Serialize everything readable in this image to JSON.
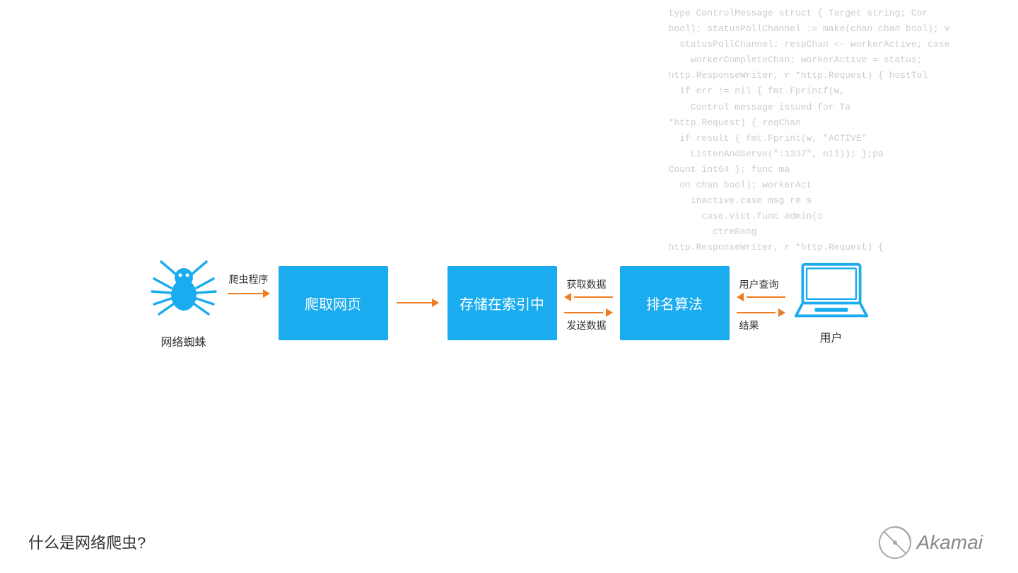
{
  "code": {
    "lines": [
      "  type ControlMessage struct { Target string; Cor",
      "  bool); statusPollChannel := make(chan chan bool); v",
      "    statusPollChannel: respChan <- workerActive; case",
      "      workerCompleteChan: workerActive = status;",
      "  http.ResponseWriter, r *http.Request) { hostTol",
      "    if err != nil { fmt.Fprintf(w,",
      "      Control message issued for Ta",
      "  *http.Request) { reqChan",
      "    if result { fmt.Fprint(w, \"ACTIVE\"",
      "      ListenAndServe(\":1337\", nil)); };pa",
      "  Count int64 }; func ma",
      "    on chan bool); workerAct",
      "      inactive.case msg re s",
      "        case.vict.func admin(c",
      "          ctreRang",
      "  http.ResponseWriter, r *http.Request) {",
      ""
    ]
  },
  "diagram": {
    "spider_label": "网络蜘蛛",
    "crawler_label": "爬虫程序",
    "box1_label": "爬取网页",
    "box2_label": "存储在索引中",
    "box3_label": "排名算法",
    "get_data_label": "获取数据",
    "send_data_label": "发送数据",
    "user_query_label": "用户查询",
    "result_label": "结果",
    "user_label": "用户"
  },
  "footer": {
    "bottom_text": "什么是网络爬虫?",
    "akamai_text": "Akamai"
  },
  "colors": {
    "blue": "#1AACEF",
    "orange": "#F07C22",
    "text_dark": "#333333",
    "code_text": "#cccccc"
  }
}
